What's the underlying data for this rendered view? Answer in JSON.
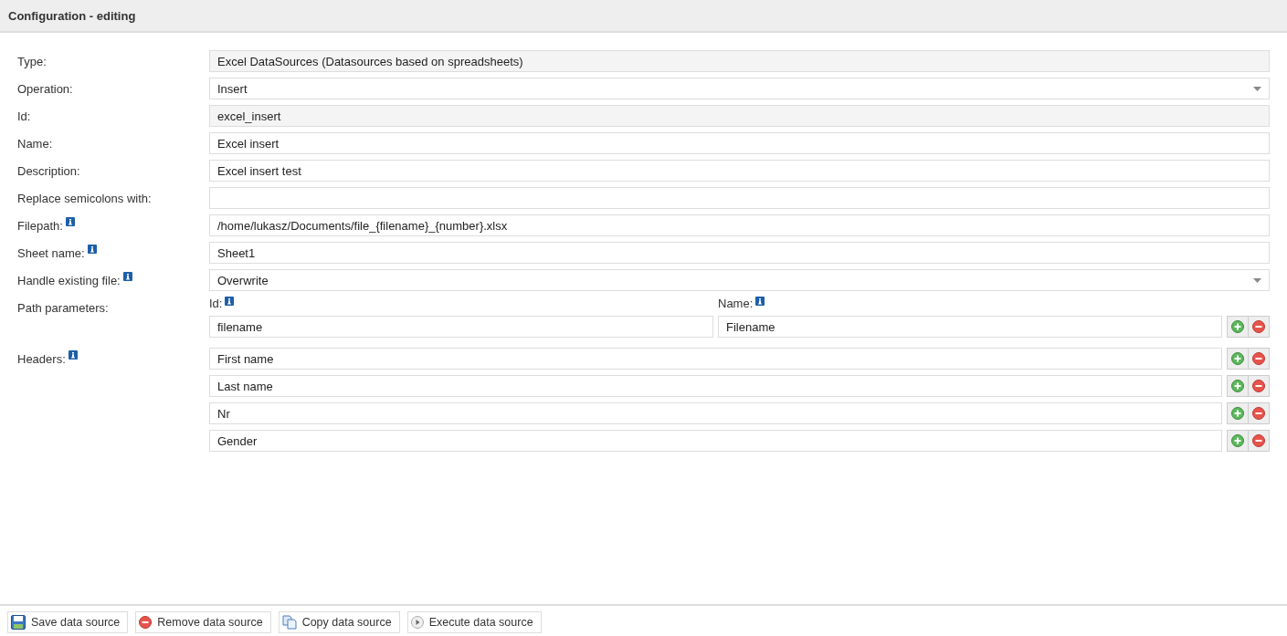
{
  "title": "Configuration - editing",
  "fields": [
    {
      "label": "Type:",
      "kind": "readonly",
      "value": "Excel DataSources (Datasources based on spreadsheets)",
      "info": false
    },
    {
      "label": "Operation:",
      "kind": "select",
      "value": "Insert",
      "info": false
    },
    {
      "label": "Id:",
      "kind": "readonly",
      "value": "excel_insert",
      "info": false
    },
    {
      "label": "Name:",
      "kind": "text",
      "value": "Excel insert",
      "info": false
    },
    {
      "label": "Description:",
      "kind": "text",
      "value": "Excel insert test",
      "info": false
    },
    {
      "label": "Replace semicolons with:",
      "kind": "text",
      "info": false
    },
    {
      "label": "Filepath:",
      "kind": "text",
      "value": "/home/lukasz/Documents/file_{filename}_{number}.xlsx",
      "info": true
    },
    {
      "label": "Sheet name:",
      "kind": "text",
      "value": "Sheet1",
      "info": true
    },
    {
      "label": "Handle existing file:",
      "kind": "select",
      "value": "Overwrite",
      "info": true
    }
  ],
  "path_parameters": {
    "label": "Path parameters:",
    "columns": [
      {
        "label": "Id:",
        "info": true
      },
      {
        "label": "Name:",
        "info": true
      }
    ],
    "rows": [
      {
        "id": "filename",
        "name": "Filename"
      }
    ]
  },
  "headers": {
    "label": "Headers:",
    "info": true,
    "items": [
      "First name",
      "Last name",
      "Nr",
      "Gender"
    ]
  },
  "buttons": [
    {
      "label": "Save data source",
      "kind": "save"
    },
    {
      "label": "Remove data source",
      "kind": "remove"
    },
    {
      "label": "Copy data source",
      "kind": "copy"
    },
    {
      "label": "Execute data source",
      "kind": "execute"
    }
  ]
}
